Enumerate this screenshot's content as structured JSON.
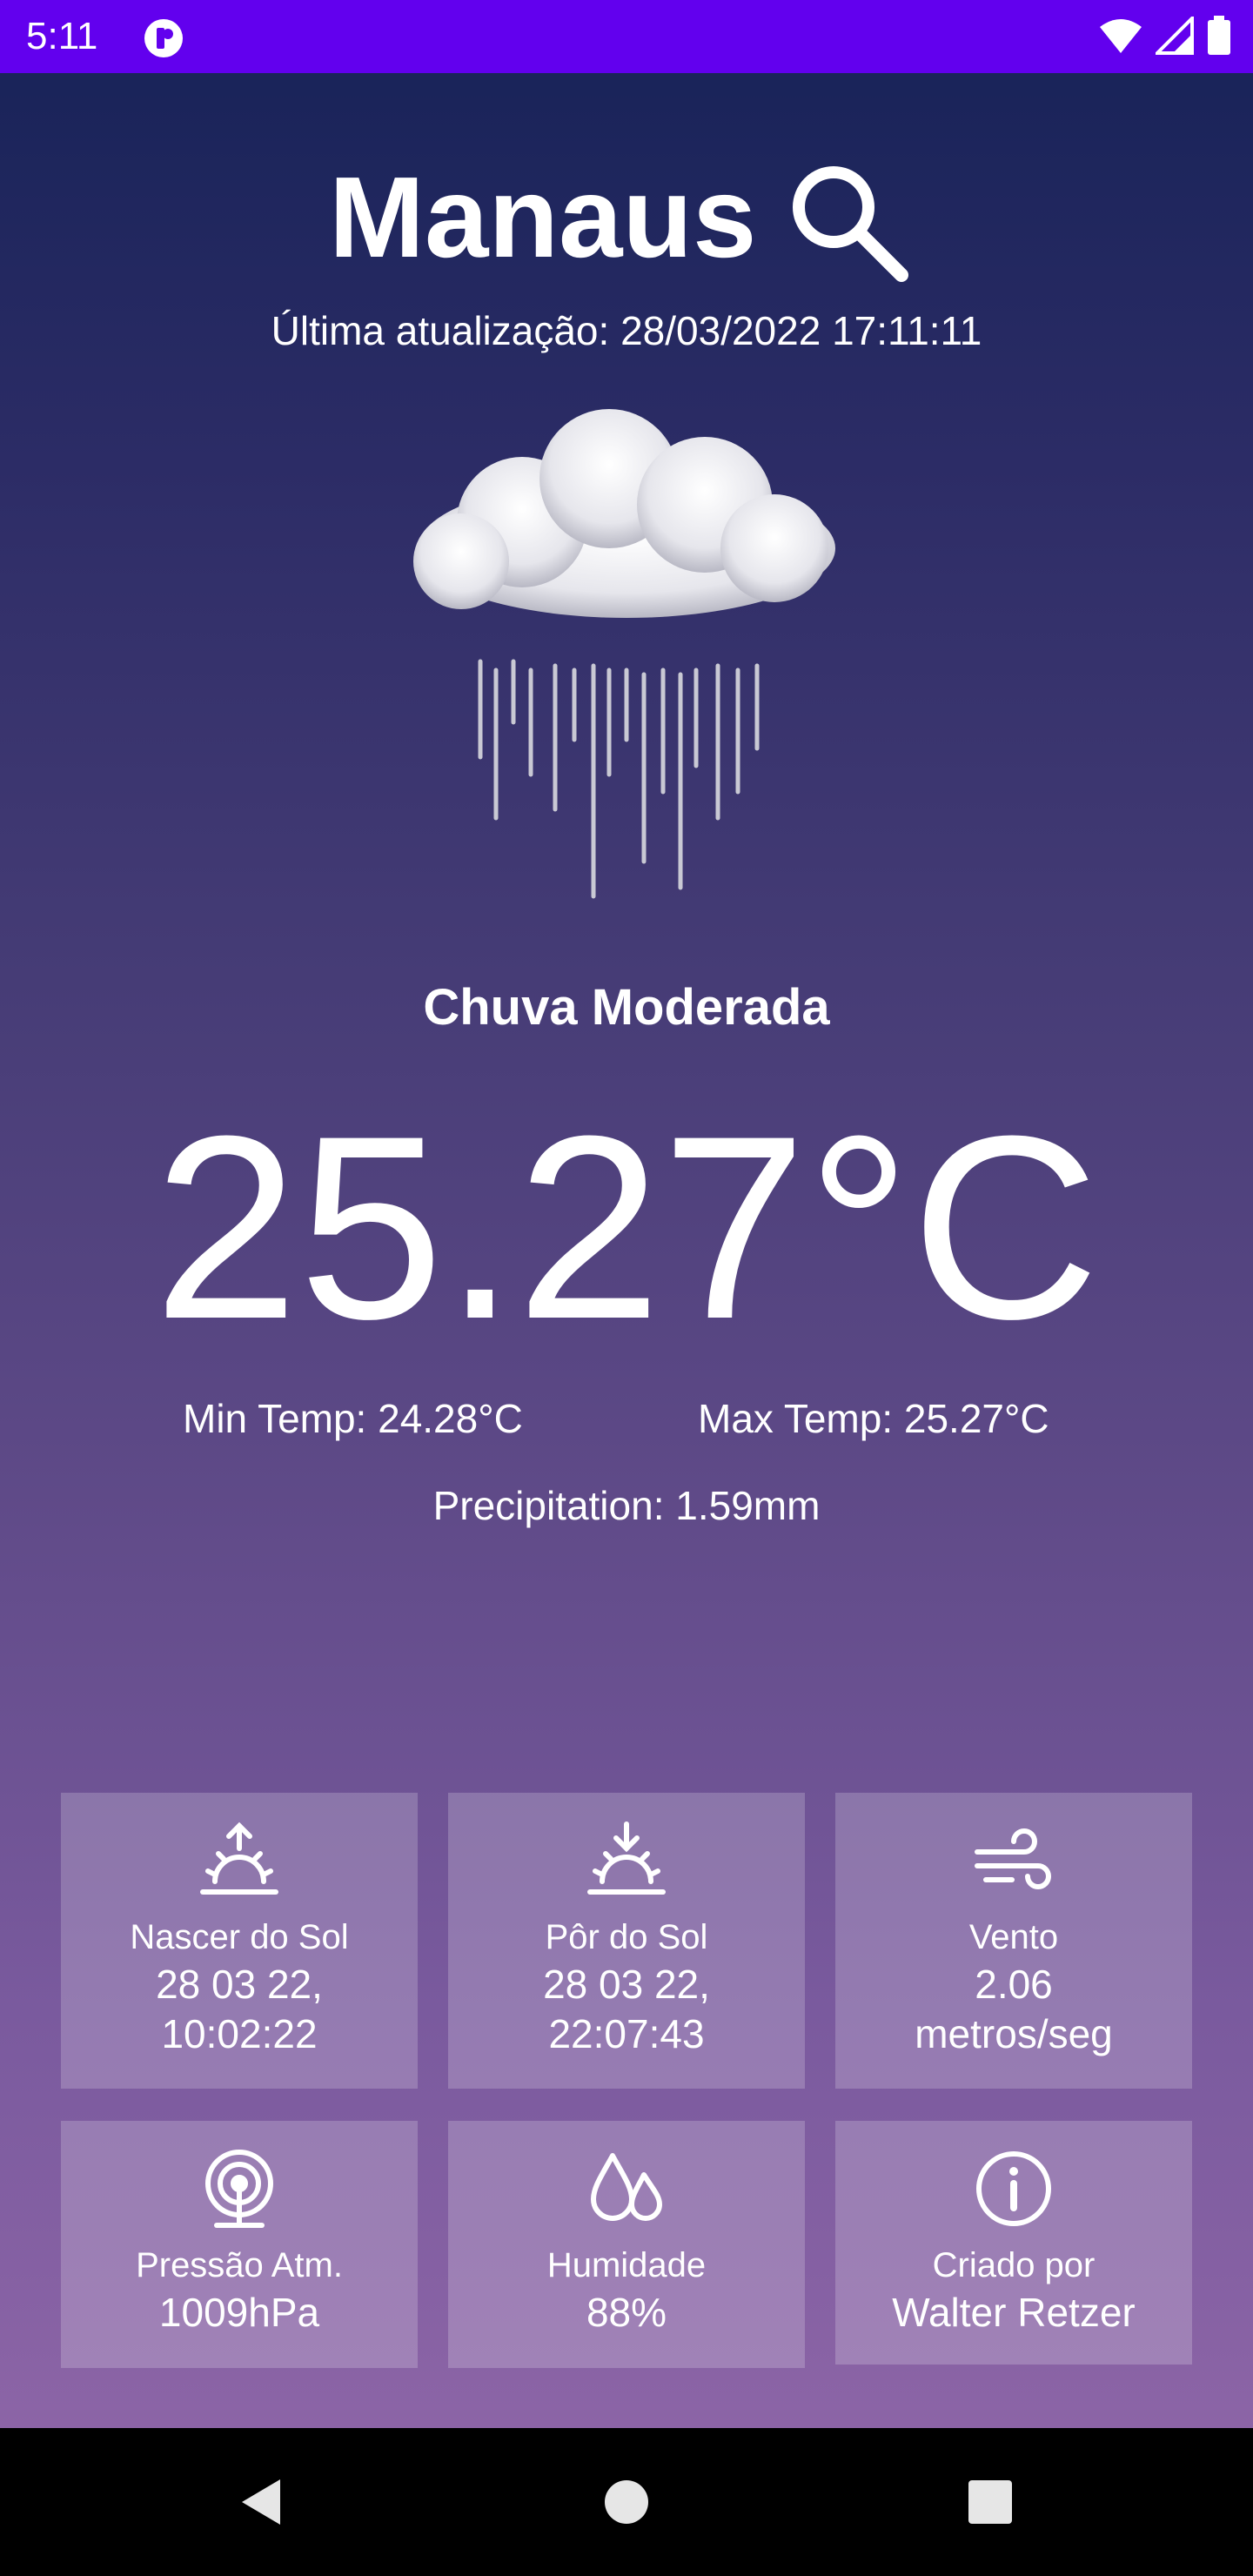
{
  "status_bar": {
    "time": "5:11"
  },
  "header": {
    "city": "Manaus"
  },
  "updated_text": "Última atualização: 28/03/2022 17:11:11",
  "weather": {
    "description": "Chuva Moderada",
    "temperature": "25.27°C",
    "min_temp": "Min Temp: 24.28°C",
    "max_temp": "Max Temp: 25.27°C",
    "precipitation": "Precipitation: 1.59mm"
  },
  "cards": [
    {
      "label": "Nascer do Sol",
      "value_line1": "28 03 22,",
      "value_line2": "10:02:22",
      "icon": "sunrise-icon"
    },
    {
      "label": "Pôr do Sol",
      "value_line1": "28 03 22,",
      "value_line2": "22:07:43",
      "icon": "sunset-icon"
    },
    {
      "label": "Vento",
      "value_line1": "2.06",
      "value_line2": "metros/seg",
      "icon": "wind-icon"
    },
    {
      "label": "Pressão Atm.",
      "value": "1009hPa",
      "icon": "pressure-icon"
    },
    {
      "label": "Humidade",
      "value": "88%",
      "icon": "humidity-icon"
    },
    {
      "label": "Criado por",
      "value": "Walter Retzer",
      "icon": "info-icon"
    }
  ],
  "colors": {
    "status_bar": "#6200ee",
    "gradient_top": "#162257",
    "gradient_bottom": "#9268a9",
    "card_bg": "rgba(255,255,255,0.2)",
    "nav_bar": "#000000"
  }
}
